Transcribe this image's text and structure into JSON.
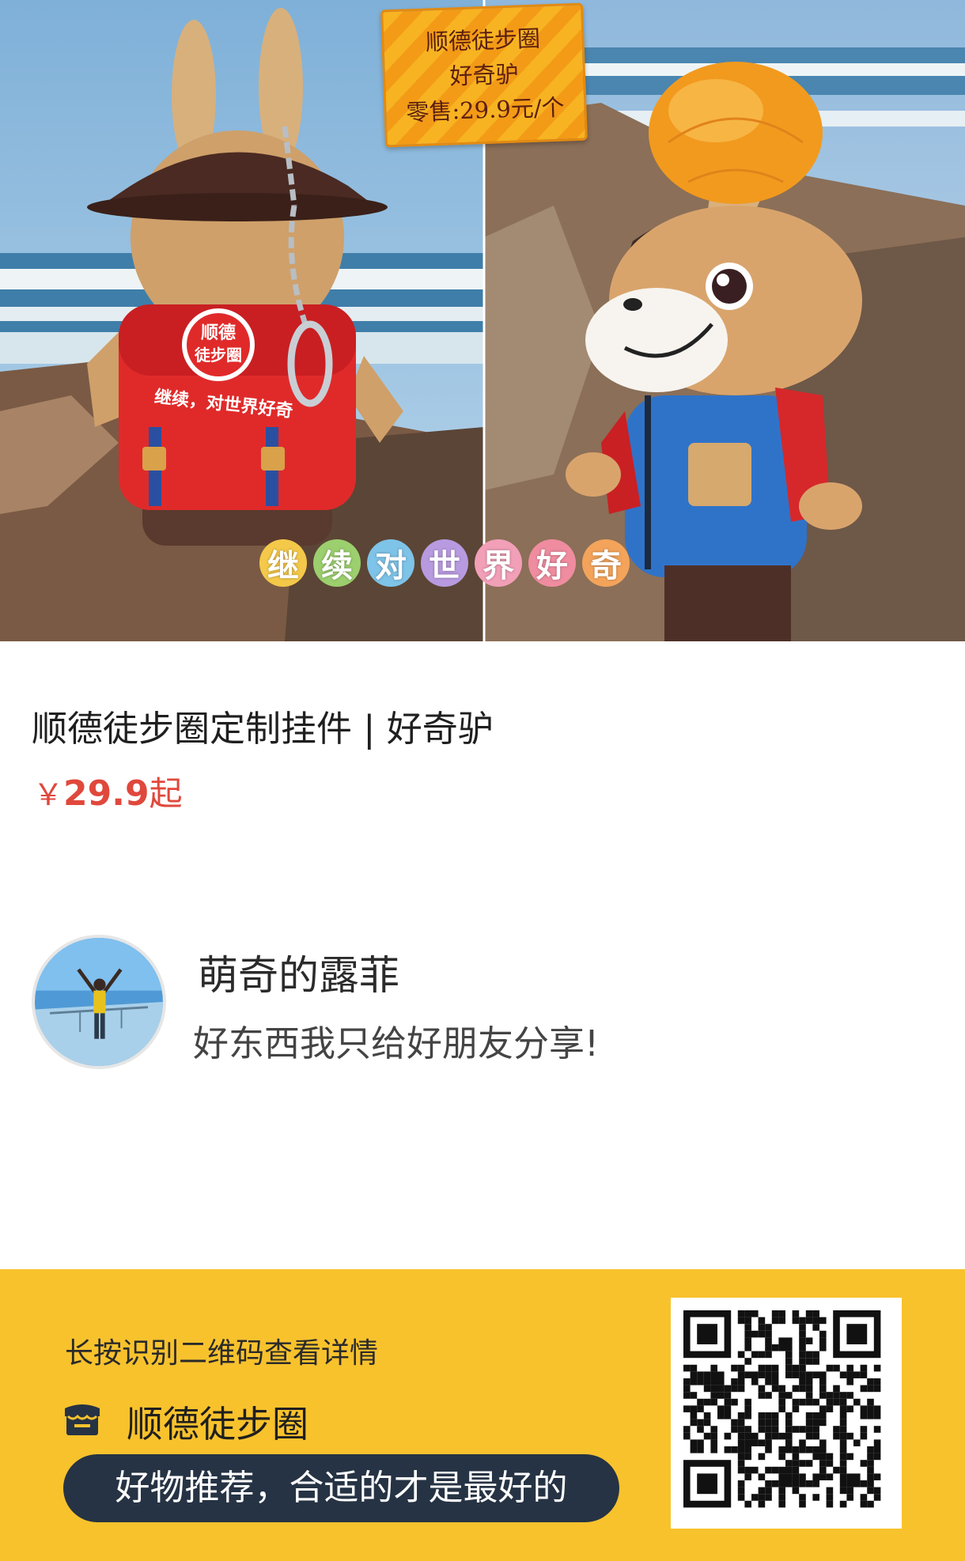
{
  "hero": {
    "banner_lines": [
      "顺德徒步圈",
      "好奇驴",
      "零售:29.9元/个"
    ],
    "slogan_chars": [
      "继",
      "续",
      "对",
      "世",
      "界",
      "好",
      "奇"
    ],
    "slogan_colors": [
      "#f4c94a",
      "#9ccf6e",
      "#7ec3e8",
      "#b89ae0",
      "#f29fb8",
      "#f08ca0",
      "#f4a45a"
    ],
    "backpack_text": "继续，对世界好奇",
    "badge_text": [
      "顺德",
      "徒步圈"
    ]
  },
  "product": {
    "title": "顺德徒步圈定制挂件 | 好奇驴",
    "price_currency": "￥",
    "price_value": "29.9",
    "price_suffix": "起"
  },
  "sharer": {
    "name": "萌奇的露菲",
    "message": "好东西我只给好朋友分享!"
  },
  "footer": {
    "hint": "长按识别二维码查看详情",
    "store_icon": "store-icon",
    "store_name": "顺德徒步圈",
    "slogan": "好物推荐，合适的才是最好的"
  },
  "colors": {
    "price": "#e0483c",
    "footer_bg": "#f8c22d",
    "slogan_bg": "#263344"
  }
}
